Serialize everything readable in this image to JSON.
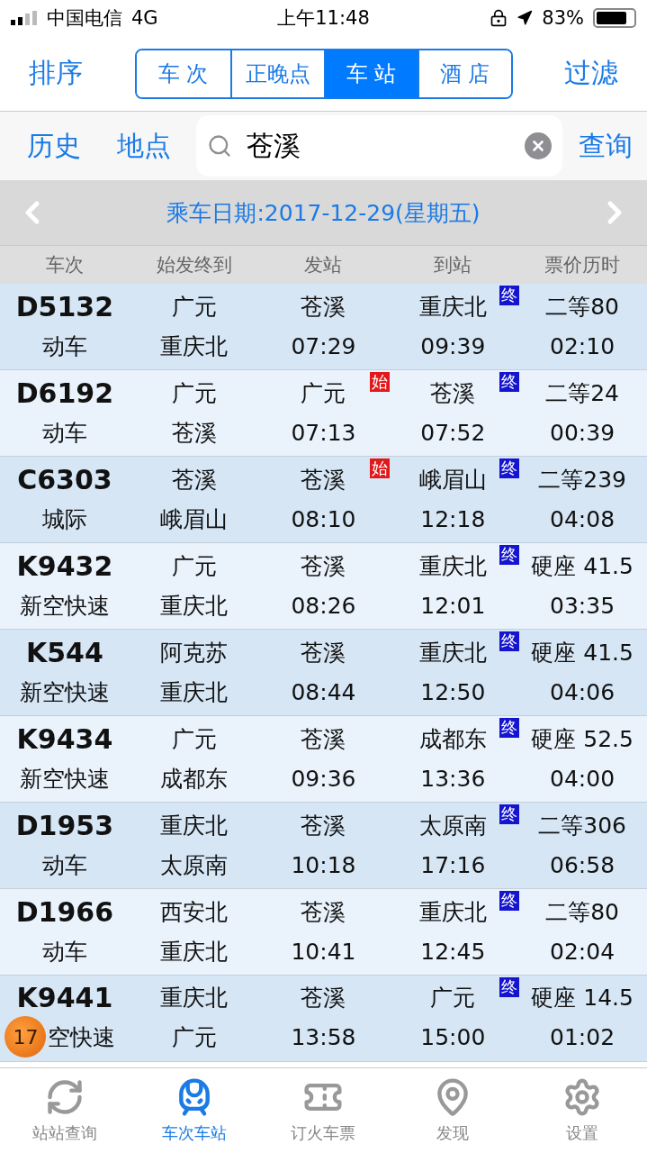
{
  "status_bar": {
    "carrier": "中国电信",
    "network": "4G",
    "time": "上午11:48",
    "battery": "83%"
  },
  "nav": {
    "left": "排序",
    "right": "过滤",
    "segments": [
      {
        "label": "车 次",
        "selected": false
      },
      {
        "label": "正晚点",
        "selected": false
      },
      {
        "label": "车 站",
        "selected": true
      },
      {
        "label": "酒 店",
        "selected": false
      }
    ]
  },
  "search_row": {
    "history": "历史",
    "place": "地点",
    "value": "苍溪",
    "query": "查询"
  },
  "date_bar": {
    "label": "乘车日期:2017-12-29(星期五)"
  },
  "table": {
    "columns": [
      "车次",
      "始发终到",
      "发站",
      "到站",
      "票价历时"
    ],
    "rows": [
      {
        "code": "D5132",
        "type": "动车",
        "origin": "广元",
        "terminus": "重庆北",
        "dep_station": "苍溪",
        "dep_time": "07:29",
        "arr_station": "重庆北",
        "arr_time": "09:39",
        "price": "二等80",
        "duration": "02:10",
        "end_mark": "终"
      },
      {
        "code": "D6192",
        "type": "动车",
        "origin": "广元",
        "terminus": "苍溪",
        "dep_station": "广元",
        "dep_time": "07:13",
        "arr_station": "苍溪",
        "arr_time": "07:52",
        "price": "二等24",
        "duration": "00:39",
        "start_mark": "始",
        "end_mark": "终"
      },
      {
        "code": "C6303",
        "type": "城际",
        "origin": "苍溪",
        "terminus": "峨眉山",
        "dep_station": "苍溪",
        "dep_time": "08:10",
        "arr_station": "峨眉山",
        "arr_time": "12:18",
        "price": "二等239",
        "duration": "04:08",
        "start_mark": "始",
        "end_mark": "终"
      },
      {
        "code": "K9432",
        "type": "新空快速",
        "origin": "广元",
        "terminus": "重庆北",
        "dep_station": "苍溪",
        "dep_time": "08:26",
        "arr_station": "重庆北",
        "arr_time": "12:01",
        "price": "硬座 41.5",
        "duration": "03:35",
        "end_mark": "终"
      },
      {
        "code": "K544",
        "type": "新空快速",
        "origin": "阿克苏",
        "terminus": "重庆北",
        "dep_station": "苍溪",
        "dep_time": "08:44",
        "arr_station": "重庆北",
        "arr_time": "12:50",
        "price": "硬座 41.5",
        "duration": "04:06",
        "end_mark": "终"
      },
      {
        "code": "K9434",
        "type": "新空快速",
        "origin": "广元",
        "terminus": "成都东",
        "dep_station": "苍溪",
        "dep_time": "09:36",
        "arr_station": "成都东",
        "arr_time": "13:36",
        "price": "硬座 52.5",
        "duration": "04:00",
        "end_mark": "终"
      },
      {
        "code": "D1953",
        "type": "动车",
        "origin": "重庆北",
        "terminus": "太原南",
        "dep_station": "苍溪",
        "dep_time": "10:18",
        "arr_station": "太原南",
        "arr_time": "17:16",
        "price": "二等306",
        "duration": "06:58",
        "end_mark": "终"
      },
      {
        "code": "D1966",
        "type": "动车",
        "origin": "西安北",
        "terminus": "重庆北",
        "dep_station": "苍溪",
        "dep_time": "10:41",
        "arr_station": "重庆北",
        "arr_time": "12:45",
        "price": "二等80",
        "duration": "02:04",
        "end_mark": "终"
      },
      {
        "code": "K9441",
        "type": "空快速",
        "origin": "重庆北",
        "terminus": "广元",
        "dep_station": "苍溪",
        "dep_time": "13:58",
        "arr_station": "广元",
        "arr_time": "15:00",
        "price": "硬座 14.5",
        "duration": "01:02",
        "end_mark": "终",
        "badge": "17"
      }
    ]
  },
  "tab_bar": [
    {
      "kind": "refresh",
      "label": "站站查询",
      "selected": false
    },
    {
      "kind": "train",
      "label": "车次车站",
      "selected": true
    },
    {
      "kind": "ticket",
      "label": "订火车票",
      "selected": false
    },
    {
      "kind": "pin",
      "label": "发现",
      "selected": false
    },
    {
      "kind": "gear",
      "label": "设置",
      "selected": false
    }
  ]
}
